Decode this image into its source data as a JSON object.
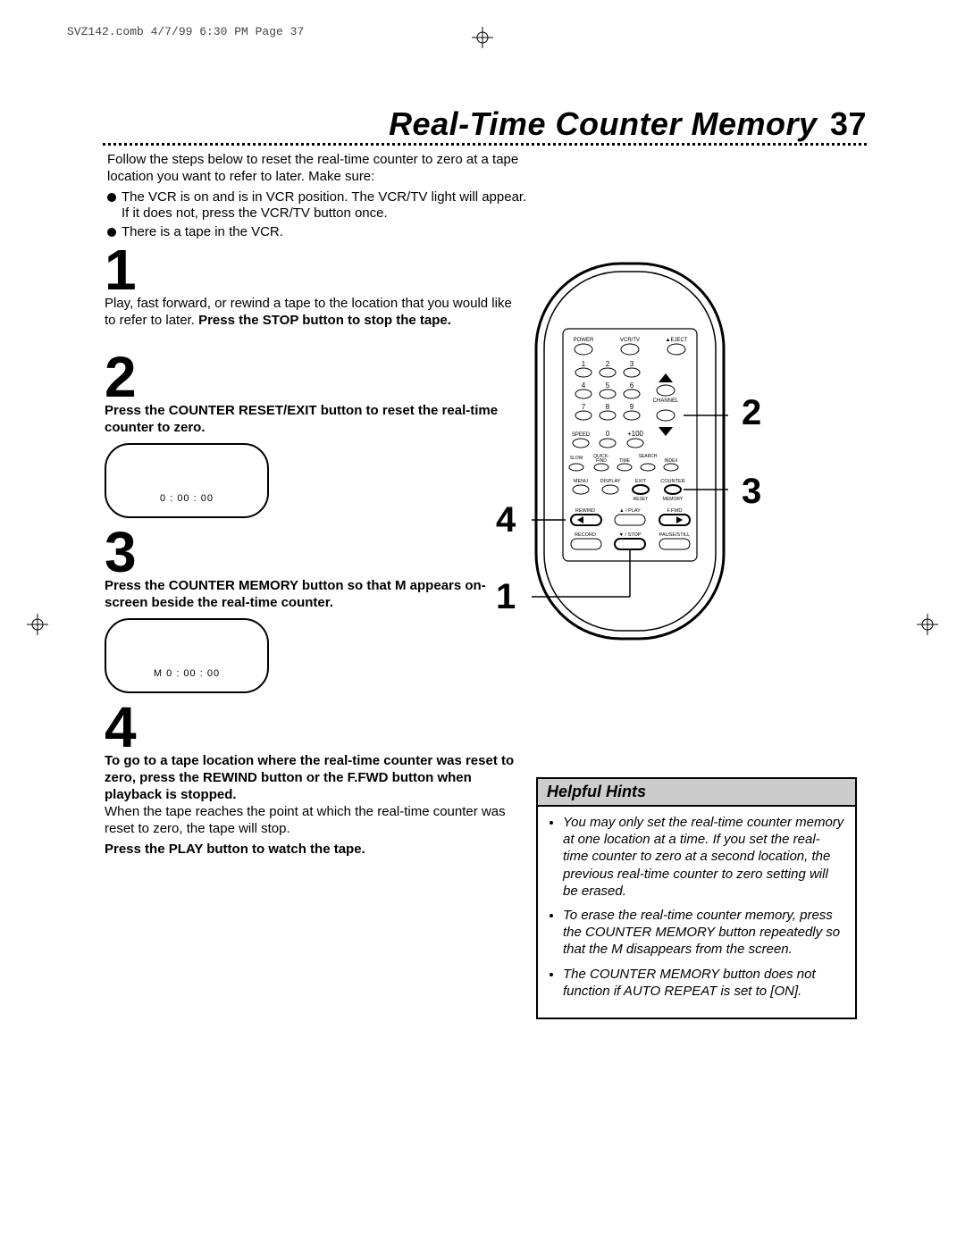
{
  "meta": {
    "slug": "SVZ142.comb  4/7/99  6:30 PM  Page 37"
  },
  "title": {
    "text": "Real-Time Counter Memory",
    "page_number": "37"
  },
  "intro": {
    "lead": "Follow the steps below to reset the real-time counter to zero at a tape location you want to refer to later. Make sure:",
    "bullets": [
      "The VCR is on and is in VCR position. The VCR/TV light will appear. If it does not, press the VCR/TV button once.",
      "There is a tape in the VCR."
    ]
  },
  "steps": [
    {
      "num": "1",
      "body_plain": "Play, fast forward, or rewind a tape to the location that you would like to refer to later. ",
      "body_bold": "Press the STOP button to stop the tape."
    },
    {
      "num": "2",
      "body_bold": "Press the COUNTER RESET/EXIT button to reset the real-time counter to zero.",
      "screen": "0 : 00 : 00"
    },
    {
      "num": "3",
      "body_bold": "Press the COUNTER MEMORY button so that M appears on-screen beside the real-time counter.",
      "screen": "M 0 : 00 : 00"
    },
    {
      "num": "4",
      "body_bold": "To go to a tape location where the real-time counter was reset to zero, press the REWIND button or the F.FWD button when playback is stopped.",
      "body_plain2": "When the tape reaches the point at which the real-time counter was reset to zero, the tape will stop.",
      "body_bold2": "Press the PLAY button to watch the tape."
    }
  ],
  "remote": {
    "row_labels": [
      "POWER",
      "VCR/TV",
      "▲EJECT"
    ],
    "numpad": [
      [
        "1",
        "2",
        "3"
      ],
      [
        "4",
        "5",
        "6"
      ],
      [
        "7",
        "8",
        "9"
      ]
    ],
    "channel": "CHANNEL",
    "speed_row": {
      "left": "SPEED",
      "mid": "0",
      "right": "+100"
    },
    "small_row": {
      "a": "SLOW",
      "b": "QUICK-\nFIND",
      "c": "TIME",
      "d": "SEARCH",
      "e": "INDEX"
    },
    "menu_row": {
      "a": "MENU",
      "b": "DISPLAY",
      "c": "EXIT",
      "d": "COUNTER"
    },
    "reset_memory": {
      "a": "RESET",
      "b": "MEMORY"
    },
    "transport": {
      "rew": "REWIND",
      "play": "▲ / PLAY",
      "ffwd": "F.FWD"
    },
    "transport2": {
      "rec": "RECORD",
      "stop": "▼ / STOP",
      "pause": "PAUSE/STILL"
    }
  },
  "callouts": {
    "c1": "1",
    "c2": "2",
    "c3": "3",
    "c4": "4"
  },
  "hints": {
    "title": "Helpful Hints",
    "items": [
      "You may only set the real-time counter memory at one location at a time. If you set the real-time counter to zero at a second location, the previous real-time counter to zero setting will be erased.",
      "To erase the real-time counter memory, press the COUNTER MEMORY button repeatedly so that the M disappears from the screen.",
      "The COUNTER MEMORY button does not function if AUTO REPEAT is set to [ON]."
    ]
  }
}
